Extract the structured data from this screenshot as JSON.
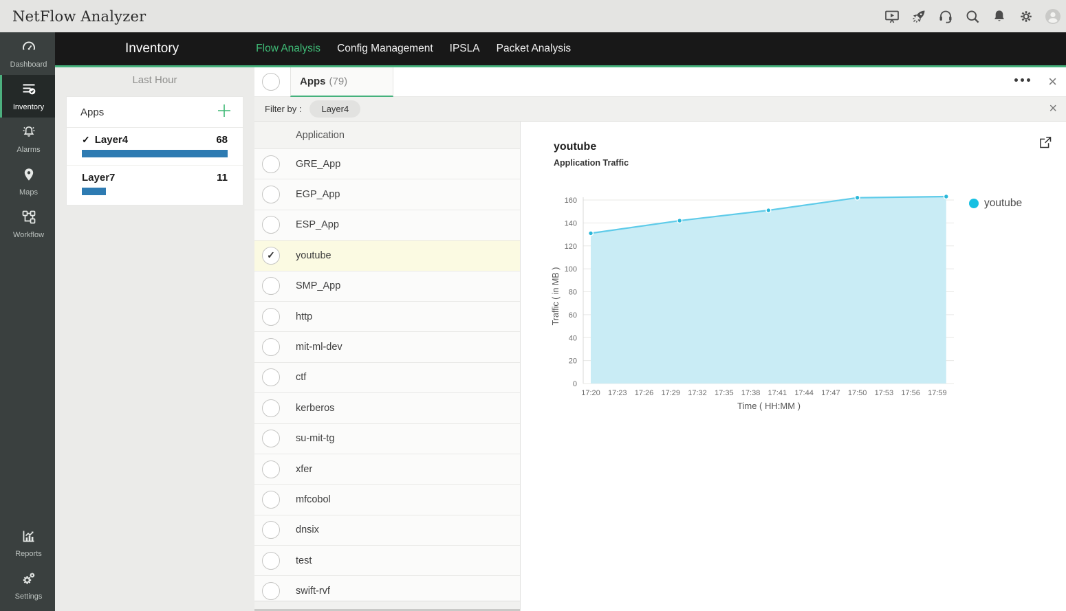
{
  "app": {
    "title": "NetFlow Analyzer"
  },
  "topbar": {
    "icons": [
      "presentation-icon",
      "launch-icon",
      "support-headset-icon",
      "search-icon",
      "notifications-bell-icon",
      "settings-gear-icon",
      "user-avatar"
    ]
  },
  "sidebar": {
    "items": [
      {
        "label": "Dashboard",
        "icon": "gauge-icon",
        "active": false
      },
      {
        "label": "Inventory",
        "icon": "inventory-list-icon",
        "active": true
      },
      {
        "label": "Alarms",
        "icon": "alarm-bell-icon",
        "active": false
      },
      {
        "label": "Maps",
        "icon": "map-pin-icon",
        "active": false
      },
      {
        "label": "Workflow",
        "icon": "workflow-icon",
        "active": false
      }
    ],
    "bottom_items": [
      {
        "label": "Reports",
        "icon": "reports-chart-icon",
        "active": false
      },
      {
        "label": "Settings",
        "icon": "gears-icon",
        "active": false
      }
    ]
  },
  "header": {
    "title": "Inventory",
    "tabs": [
      {
        "label": "Flow Analysis",
        "active": true
      },
      {
        "label": "Config Management",
        "active": false
      },
      {
        "label": "IPSLA",
        "active": false
      },
      {
        "label": "Packet Analysis",
        "active": false
      }
    ]
  },
  "filter_panel": {
    "period": "Last Hour",
    "group_title": "Apps",
    "categories": [
      {
        "label": "Layer4",
        "count": "68",
        "checked": true,
        "bar_pct": 100
      },
      {
        "label": "Layer7",
        "count": "11",
        "checked": false,
        "bar_pct": 16.5
      }
    ]
  },
  "list_panel": {
    "tab": {
      "label": "Apps",
      "count": "(79)"
    },
    "filter": {
      "label": "Filter by :",
      "chip": "Layer4"
    },
    "column_header": "Application",
    "items": [
      {
        "name": "GRE_App",
        "selected": false
      },
      {
        "name": "EGP_App",
        "selected": false
      },
      {
        "name": "ESP_App",
        "selected": false
      },
      {
        "name": "youtube",
        "selected": true
      },
      {
        "name": "SMP_App",
        "selected": false
      },
      {
        "name": "http",
        "selected": false
      },
      {
        "name": "mit-ml-dev",
        "selected": false
      },
      {
        "name": "ctf",
        "selected": false
      },
      {
        "name": "kerberos",
        "selected": false
      },
      {
        "name": "su-mit-tg",
        "selected": false
      },
      {
        "name": "xfer",
        "selected": false
      },
      {
        "name": "mfcobol",
        "selected": false
      },
      {
        "name": "dnsix",
        "selected": false
      },
      {
        "name": "test",
        "selected": false
      },
      {
        "name": "swift-rvf",
        "selected": false
      }
    ]
  },
  "chart_panel": {
    "title": "youtube",
    "subtitle": "Application Traffic",
    "legend": "youtube"
  },
  "chart_data": {
    "type": "area",
    "title": "youtube Application Traffic",
    "x": [
      "17:20",
      "17:30",
      "17:40",
      "17:50",
      "18:00"
    ],
    "x_minutes": [
      0,
      10,
      20,
      30,
      40
    ],
    "values": [
      131,
      142,
      151,
      162,
      163
    ],
    "series": [
      {
        "name": "youtube",
        "values": [
          131,
          142,
          151,
          162,
          163
        ]
      }
    ],
    "x_ticks": [
      "17:20",
      "17:23",
      "17:26",
      "17:29",
      "17:32",
      "17:35",
      "17:38",
      "17:41",
      "17:44",
      "17:47",
      "17:50",
      "17:53",
      "17:56",
      "17:59"
    ],
    "x_tick_minutes": [
      0,
      3,
      6,
      9,
      12,
      15,
      18,
      21,
      24,
      27,
      30,
      33,
      36,
      39
    ],
    "y_ticks": [
      0,
      20,
      40,
      60,
      80,
      100,
      120,
      140,
      160
    ],
    "ylim": [
      0,
      160
    ],
    "xlabel": "Time ( HH:MM )",
    "ylabel": "Traffic ( in MB )",
    "grid": true,
    "legend_position": "right"
  },
  "colors": {
    "accent_green": "#3fbc77",
    "underline_green": "#45b17c",
    "bar_blue": "#2e7bb2",
    "selected_row_yellow": "#fbfae2",
    "chart_line": "#5ecbe9",
    "chart_fill": "#c9ecf5",
    "chart_dot": "#29b7d9",
    "legend_dot": "#16c0e2"
  }
}
